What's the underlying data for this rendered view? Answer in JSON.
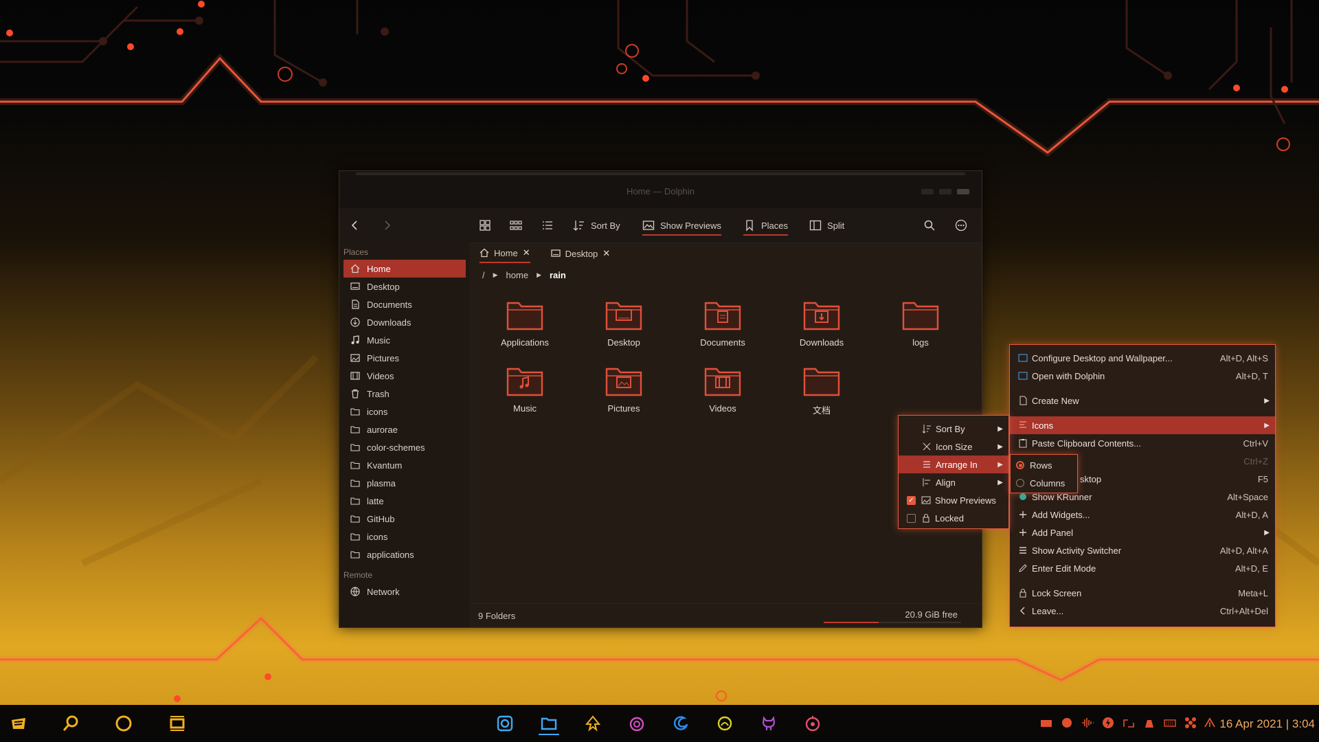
{
  "window": {
    "title": "Home — Dolphin",
    "toolbar": {
      "sort_by": "Sort By",
      "show_previews": "Show Previews",
      "places": "Places",
      "split": "Split"
    },
    "sidebar": {
      "places_heading": "Places",
      "items": [
        {
          "label": "Home",
          "icon": "home-icon",
          "selected": true
        },
        {
          "label": "Desktop",
          "icon": "desktop-icon"
        },
        {
          "label": "Documents",
          "icon": "documents-icon"
        },
        {
          "label": "Downloads",
          "icon": "downloads-icon"
        },
        {
          "label": "Music",
          "icon": "music-icon"
        },
        {
          "label": "Pictures",
          "icon": "pictures-icon"
        },
        {
          "label": "Videos",
          "icon": "videos-icon"
        },
        {
          "label": "Trash",
          "icon": "trash-icon"
        },
        {
          "label": "icons",
          "icon": "folder-icon"
        },
        {
          "label": "aurorae",
          "icon": "folder-icon"
        },
        {
          "label": "color-schemes",
          "icon": "folder-icon"
        },
        {
          "label": "Kvantum",
          "icon": "folder-icon"
        },
        {
          "label": "plasma",
          "icon": "folder-icon"
        },
        {
          "label": "latte",
          "icon": "folder-icon"
        },
        {
          "label": "GitHub",
          "icon": "folder-icon"
        },
        {
          "label": "icons",
          "icon": "folder-icon"
        },
        {
          "label": "applications",
          "icon": "folder-icon"
        }
      ],
      "remote_heading": "Remote",
      "remote_items": [
        {
          "label": "Network",
          "icon": "network-icon"
        }
      ]
    },
    "tabs": [
      {
        "label": "Home",
        "active": true
      },
      {
        "label": "Desktop",
        "active": false
      }
    ],
    "breadcrumb": {
      "root": "/",
      "parts": [
        "home",
        "rain"
      ]
    },
    "files": [
      {
        "label": "Applications",
        "kind": "folder"
      },
      {
        "label": "Desktop",
        "kind": "desktop"
      },
      {
        "label": "Documents",
        "kind": "documents"
      },
      {
        "label": "Downloads",
        "kind": "downloads"
      },
      {
        "label": "logs",
        "kind": "folder"
      },
      {
        "label": "Music",
        "kind": "music"
      },
      {
        "label": "Pictures",
        "kind": "pictures"
      },
      {
        "label": "Videos",
        "kind": "videos"
      },
      {
        "label": "文档",
        "kind": "folder"
      }
    ],
    "status": {
      "count": "9 Folders",
      "free": "20.9 GiB free",
      "used_fraction": 0.4
    }
  },
  "context_menu": {
    "items": [
      {
        "label": "Configure Desktop and Wallpaper...",
        "shortcut": "Alt+D, Alt+S"
      },
      {
        "label": "Open with Dolphin",
        "shortcut": "Alt+D, T"
      },
      {
        "label": "Create New",
        "submenu": true
      },
      {
        "label": "Icons",
        "submenu": true,
        "highlighted": true
      },
      {
        "label": "Paste Clipboard Contents...",
        "shortcut": "Ctrl+V"
      },
      {
        "label": "",
        "shortcut": "Ctrl+Z"
      },
      {
        "label": "sktop",
        "shortcut": "F5"
      },
      {
        "label": "Show KRunner",
        "shortcut": "Alt+Space"
      },
      {
        "label": "Add Widgets...",
        "shortcut": "Alt+D, A"
      },
      {
        "label": "Add Panel",
        "submenu": true
      },
      {
        "label": "Show Activity Switcher",
        "shortcut": "Alt+D, Alt+A"
      },
      {
        "label": "Enter Edit Mode",
        "shortcut": "Alt+D, E"
      },
      {
        "label": "Lock Screen",
        "shortcut": "Meta+L"
      },
      {
        "label": "Leave...",
        "shortcut": "Ctrl+Alt+Del"
      }
    ]
  },
  "icons_menu": {
    "items": [
      {
        "label": "Sort By",
        "submenu": true
      },
      {
        "label": "Icon Size",
        "submenu": true
      },
      {
        "label": "Arrange In",
        "submenu": true,
        "highlighted": true
      },
      {
        "label": "Align",
        "submenu": true
      },
      {
        "label": "Show Previews",
        "checked": true
      },
      {
        "label": "Locked",
        "checked": false
      }
    ]
  },
  "arrange_menu": {
    "items": [
      {
        "label": "Rows",
        "selected": true
      },
      {
        "label": "Columns",
        "selected": false
      }
    ]
  },
  "taskbar": {
    "clock": "16 Apr 2021 | 3:04",
    "apps": [
      "menu-icon",
      "search-icon",
      "circle-icon",
      "window-switch-icon",
      "screenshot-icon",
      "dolphin-icon",
      "inkscape-icon",
      "firefox-icon",
      "edge-icon",
      "chat-icon",
      "github-icon",
      "music-icon"
    ]
  },
  "colors": {
    "accent": "#c0392b",
    "glow": "#e35a3d",
    "highlight": "#a8342a",
    "clock": "#f0a860"
  }
}
